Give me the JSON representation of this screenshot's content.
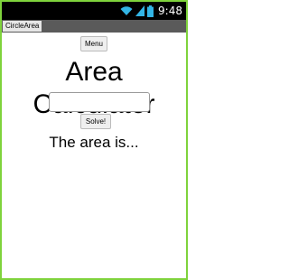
{
  "status_bar": {
    "time": "9:48",
    "icons": [
      "wifi-icon",
      "signal-icon",
      "battery-icon"
    ],
    "icon_color": "#33b5e5"
  },
  "app": {
    "title": "CircleArea"
  },
  "controls": {
    "menu_label": "Menu",
    "input_value": "",
    "input_placeholder": "",
    "solve_label": "Solve!"
  },
  "main": {
    "title": "Area Calculator",
    "result_text": "The area is..."
  },
  "colors": {
    "border": "#7fd33c",
    "titlebar": "#5a5a5a",
    "statusbar": "#000000"
  }
}
